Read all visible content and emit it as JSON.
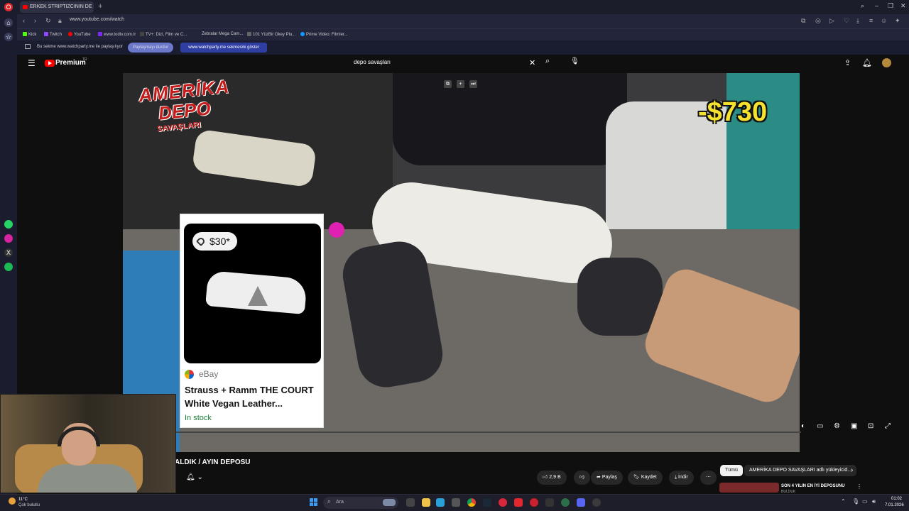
{
  "browser": {
    "tab_title": "ERKEK STRIPTIZCININ DE",
    "new_tab": "+",
    "url": "www.youtube.com/watch",
    "bookmarks": [
      "Kick",
      "Twitch",
      "YouTube",
      "www.todtv.com.tr",
      "TV+: Dizi, Film ve C...",
      "Zebralar Mega Cam...",
      "101 YüzBir Okey Plu...",
      "Prime Video: Filmler..."
    ],
    "share_bar": {
      "text": "Bu sekme www.watchparty.me ile paylaşılıyor",
      "stop_label": "Paylaşmayı durdur",
      "show_label": "www.watchparty.me sekmesini göster"
    }
  },
  "youtube": {
    "premium_label": "Premium",
    "region": "TR",
    "search_value": "depo savaşları",
    "video_overlay": {
      "title_line1": "AMERİKA",
      "title_line2": "DEPO",
      "title_line3": "SAVAŞLARI",
      "price": "-$730"
    },
    "ebay_card": {
      "price": "$30*",
      "source": "eBay",
      "title": "Strauss + Ramm THE COURT White Vegan Leather...",
      "stock": "In stock"
    },
    "video_title": "ALDIK / AYIN DEPOSU",
    "actions": {
      "likes": "2,9 B",
      "share": "Paylaş",
      "save": "Kaydet",
      "download": "İndir"
    },
    "chips": [
      "Tümü",
      "AMERİKA DEPO SAVAŞLARI adlı yükleyicid..."
    ],
    "recommended": {
      "title": "SON 4 YILIN EN İYİ DEPOSUNU",
      "channel": "BULDUK"
    }
  },
  "taskbar": {
    "weather_temp": "11°C",
    "weather_desc": "Çok bulutlu",
    "search_label": "Ara",
    "time": "01:02",
    "date": "7.01.2026"
  },
  "colors": {
    "yt_red": "#ff0000",
    "price_yellow": "#f4e22f",
    "share_accent": "#2f3ea3"
  }
}
